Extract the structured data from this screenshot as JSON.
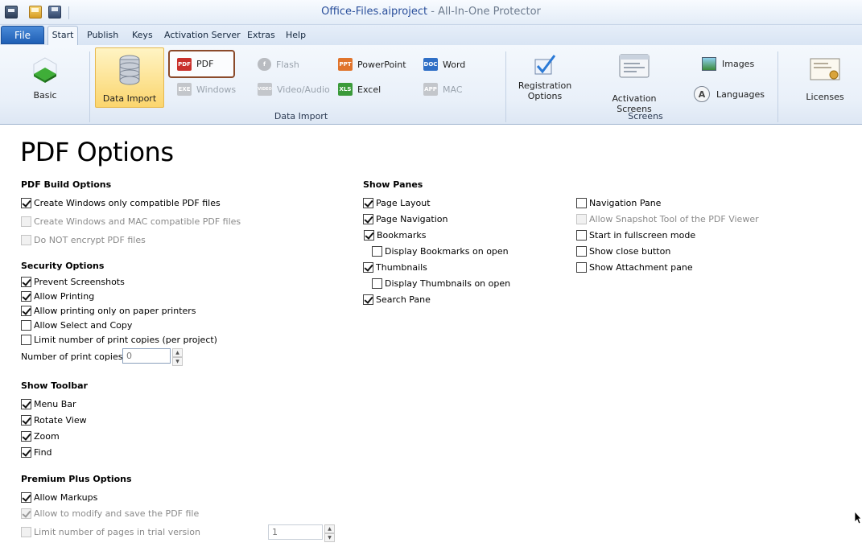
{
  "window": {
    "project_name": "Office-Files.aiproject",
    "title_separator": " - ",
    "app_name": "All-In-One Protector"
  },
  "quick_access": [
    {
      "icon": "app-menu-icon"
    },
    {
      "icon": "open-folder-icon"
    },
    {
      "icon": "save-icon"
    }
  ],
  "tabs": {
    "file": "File",
    "items": [
      "Start",
      "Publish",
      "Keys",
      "Activation Server",
      "Extras",
      "Help"
    ],
    "active": "Start"
  },
  "ribbon": {
    "basic_label": "Basic",
    "data_import_btn": "Data Import",
    "data_import_group": "Data Import",
    "formats": {
      "pdf": {
        "label": "PDF",
        "badge": "PDF",
        "enabled": true,
        "selected": true
      },
      "windows": {
        "label": "Windows",
        "badge": "EXE",
        "enabled": false
      },
      "flash": {
        "label": "Flash",
        "enabled": false
      },
      "video": {
        "label": "Video/Audio",
        "badge": "VIDEO",
        "enabled": false
      },
      "powerpoint": {
        "label": "PowerPoint",
        "badge": "PPT",
        "enabled": true
      },
      "excel": {
        "label": "Excel",
        "badge": "XLS",
        "enabled": true
      },
      "word": {
        "label": "Word",
        "badge": "DOC",
        "enabled": true
      },
      "mac": {
        "label": "MAC",
        "badge": "APP",
        "enabled": false
      }
    },
    "registration_line1": "Registration",
    "registration_line2": "Options",
    "activation_screens": "Activation Screens",
    "images": "Images",
    "languages": "Languages",
    "screens_group": "Screens",
    "licenses": "Licenses"
  },
  "page": {
    "title": "PDF Options",
    "build": {
      "heading": "PDF Build Options",
      "items": [
        {
          "label": "Create Windows only compatible PDF files",
          "checked": true,
          "enabled": true
        },
        {
          "label": "Create Windows and MAC compatible PDF files",
          "checked": false,
          "enabled": false
        },
        {
          "label": "Do NOT encrypt PDF files",
          "checked": false,
          "enabled": false
        }
      ]
    },
    "security": {
      "heading": "Security Options",
      "items": [
        {
          "label": "Prevent Screenshots",
          "checked": true,
          "enabled": true
        },
        {
          "label": "Allow Printing",
          "checked": true,
          "enabled": true
        },
        {
          "label": "Allow printing only on paper printers",
          "checked": true,
          "enabled": true
        },
        {
          "label": "Allow Select and Copy",
          "checked": false,
          "enabled": true
        },
        {
          "label": "Limit number of print copies (per project)",
          "checked": false,
          "enabled": true
        }
      ],
      "copies_label": "Number of print copies",
      "copies_value": "0"
    },
    "toolbar": {
      "heading": "Show Toolbar",
      "items": [
        {
          "label": "Menu Bar",
          "checked": true,
          "enabled": true
        },
        {
          "label": "Rotate View",
          "checked": true,
          "enabled": true
        },
        {
          "label": "Zoom",
          "checked": true,
          "enabled": true
        },
        {
          "label": "Find",
          "checked": true,
          "enabled": true
        }
      ]
    },
    "premium": {
      "heading": "Premium Plus Options",
      "items": [
        {
          "label": "Allow Markups",
          "checked": true,
          "enabled": true
        },
        {
          "label": "Allow to modify and save the PDF file",
          "checked": true,
          "enabled": false
        },
        {
          "label": "Limit number of pages in trial version",
          "checked": false,
          "enabled": false
        }
      ],
      "pages_value": "1"
    },
    "panes": {
      "heading": "Show Panes",
      "left": [
        {
          "label": "Page Layout",
          "checked": true,
          "enabled": true
        },
        {
          "label": "Page Navigation",
          "checked": true,
          "enabled": true
        },
        {
          "label": "Bookmarks",
          "checked": true,
          "enabled": true
        },
        {
          "label": "Display Bookmarks on open",
          "checked": false,
          "enabled": true
        },
        {
          "label": "Thumbnails",
          "checked": true,
          "enabled": true
        },
        {
          "label": "Display Thumbnails on open",
          "checked": false,
          "enabled": true
        },
        {
          "label": "Search Pane",
          "checked": true,
          "enabled": true
        }
      ],
      "right": [
        {
          "label": "Navigation Pane",
          "checked": false,
          "enabled": true
        },
        {
          "label": "Allow Snapshot Tool of the PDF Viewer",
          "checked": false,
          "enabled": false
        },
        {
          "label": "Start in fullscreen mode",
          "checked": false,
          "enabled": true
        },
        {
          "label": "Show close button",
          "checked": false,
          "enabled": true
        },
        {
          "label": "Show Attachment pane",
          "checked": false,
          "enabled": true
        }
      ]
    }
  }
}
